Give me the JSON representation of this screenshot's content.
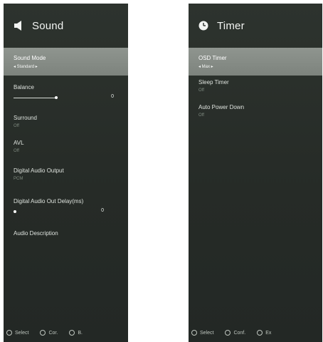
{
  "sound_panel": {
    "title": "Sound",
    "items": [
      {
        "label": "Sound Mode",
        "value": "◂ Standard ▸"
      },
      {
        "label": "Balance",
        "slider_value": "0",
        "slider_fraction": 0.5
      },
      {
        "label": "Surround",
        "value": "Off"
      },
      {
        "label": "AVL",
        "value": "Off"
      },
      {
        "label": "Digital Audio Output",
        "value": "PCM"
      },
      {
        "label": "Digital Audio Out Delay(ms)",
        "slider_value": "0",
        "slider_fraction": 0.0
      },
      {
        "label": "Audio Description"
      }
    ],
    "footer": {
      "select": "Select",
      "confirm": "Cor.",
      "back": "B."
    }
  },
  "timer_panel": {
    "title": "Timer",
    "items": [
      {
        "label": "OSD Timer",
        "value": "◂ Max ▸"
      },
      {
        "label": "Sleep Timer",
        "value": "Off"
      },
      {
        "label": "Auto Power Down",
        "value": "Off"
      }
    ],
    "footer": {
      "select": "Select",
      "confirm": "Conf.",
      "back": "Ex"
    }
  }
}
